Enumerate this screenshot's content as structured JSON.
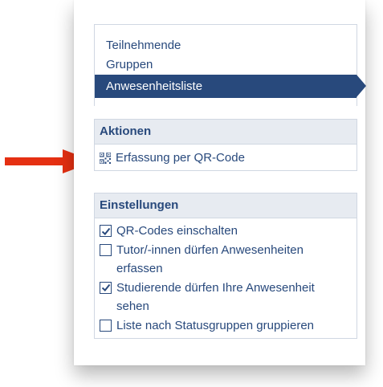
{
  "nav": {
    "items": [
      {
        "label": "Teilnehmende",
        "active": false
      },
      {
        "label": "Gruppen",
        "active": false
      },
      {
        "label": "Anwesenheitsliste",
        "active": true
      }
    ]
  },
  "actions": {
    "title": "Aktionen",
    "items": [
      {
        "label": "Erfassung per QR-Code",
        "icon": "qr-code-icon"
      }
    ]
  },
  "settings": {
    "title": "Einstellungen",
    "items": [
      {
        "line1": "QR-Codes einschalten",
        "line2": "",
        "checked": true
      },
      {
        "line1": "Tutor/-innen dürfen Anwesenheiten",
        "line2": "erfassen",
        "checked": false
      },
      {
        "line1": "Studierende dürfen Ihre Anwesenheit",
        "line2": "sehen",
        "checked": true
      },
      {
        "line1": "Liste nach Statusgruppen gruppieren",
        "line2": "",
        "checked": false
      }
    ]
  },
  "colors": {
    "accent": "#28497c",
    "arrow": "#e53012",
    "header_bg": "#e7ebf1"
  }
}
